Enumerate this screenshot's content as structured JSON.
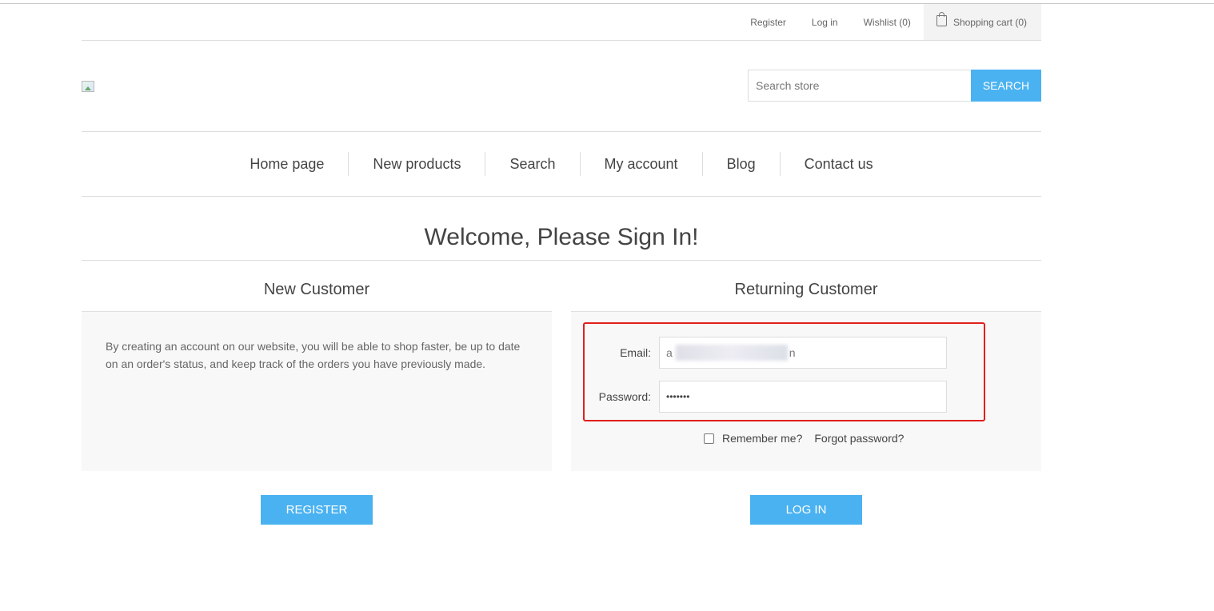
{
  "header": {
    "links": [
      "Register",
      "Log in",
      "Wishlist (0)"
    ],
    "cart_label": "Shopping cart (0)"
  },
  "search": {
    "placeholder": "Search store",
    "button_label": "SEARCH"
  },
  "menu": {
    "items": [
      "Home page",
      "New products",
      "Search",
      "My account",
      "Blog",
      "Contact us"
    ]
  },
  "page": {
    "title": "Welcome, Please Sign In!"
  },
  "new_customer": {
    "title": "New Customer",
    "text": "By creating an account on our website, you will be able to shop faster, be up to date on an order's status, and keep track of the orders you have previously made.",
    "button_label": "REGISTER"
  },
  "returning_customer": {
    "title": "Returning Customer",
    "email_label": "Email:",
    "email_visible_start": "a",
    "email_visible_end": "n",
    "password_label": "Password:",
    "password_value": "•••••••",
    "remember_label": "Remember me?",
    "forgot_label": "Forgot password?",
    "button_label": "LOG IN"
  },
  "colors": {
    "accent": "#4ab2f1",
    "highlight": "#e0201c"
  }
}
